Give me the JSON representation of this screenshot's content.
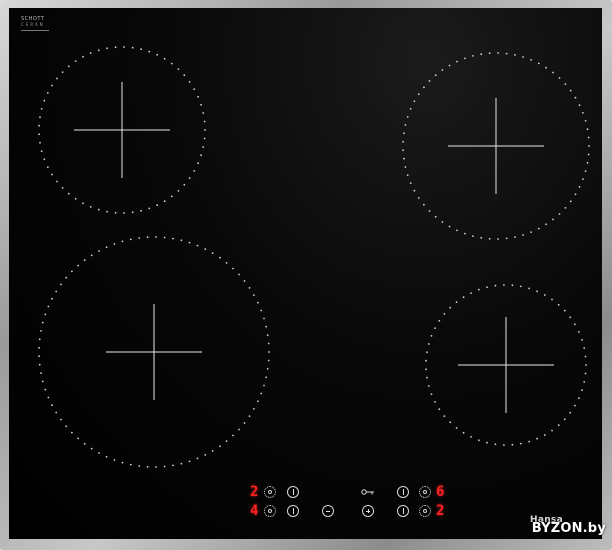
{
  "glass_brand": {
    "name": "SCHOTT",
    "sub": "CERAN"
  },
  "displays": {
    "top_left": "2",
    "bottom_left": "4",
    "top_right": "6",
    "bottom_right": "2"
  },
  "logo_text": "Hansa",
  "watermark": "BYZON.by",
  "colors": {
    "glass": "#000000",
    "frame": "#b0b0b0",
    "display_red": "#ff2020",
    "zone_dots": "#d0d0d0"
  },
  "icons": [
    "power-icon",
    "timer-icon",
    "minus-icon",
    "plus-icon",
    "key-lock-icon"
  ]
}
